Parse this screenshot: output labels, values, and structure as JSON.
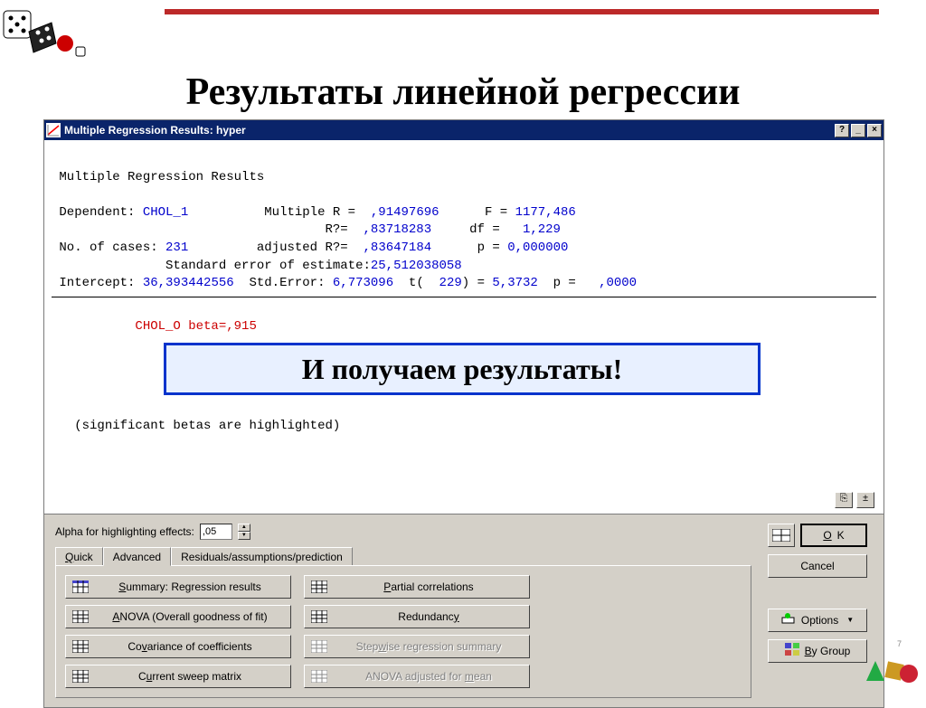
{
  "slide": {
    "title": "Результаты линейной регрессии",
    "callout": "И получаем результаты!"
  },
  "window": {
    "title": "Multiple Regression Results: hyper",
    "help_btn": "?",
    "min_btn": "_",
    "close_btn": "×"
  },
  "results": {
    "header": "Multiple Regression Results",
    "dep_label": "Dependent:",
    "dep_value": "CHOL_1",
    "multR_label": "Multiple R =",
    "multR_value": ",91497696",
    "F_label": "F =",
    "F_value": "1177,486",
    "R2_label": "R?=",
    "R2_value": ",83718283",
    "df_label": "df =",
    "df_value": "1,229",
    "ncases_label": "No. of cases:",
    "ncases_value": "231",
    "adjR2_label": "adjusted R?=",
    "adjR2_value": ",83647184",
    "p_label": "p =",
    "p_value": "0,000000",
    "stderr_label": "Standard error of estimate:",
    "stderr_value": "25,512038058",
    "intercept_label": "Intercept:",
    "intercept_value": "36,393442556",
    "std_err2_label": "Std.Error:",
    "std_err2_value": "6,773096",
    "t_label": "t(",
    "t_df": "229",
    "t_close": ") =",
    "t_value": "5,3732",
    "p2_label": "p =",
    "p2_value": ",0000",
    "beta_line": "CHOL_O beta=,915",
    "footnote": "(significant betas are highlighted)"
  },
  "controls": {
    "alpha_label": "Alpha for highlighting effects:",
    "alpha_value": ",05",
    "tabs": {
      "quick": "Quick",
      "advanced": "Advanced",
      "residuals": "Residuals/assumptions/prediction"
    },
    "buttons_left": {
      "summary": "Summary:  Regression results",
      "anova": "ANOVA (Overall goodness of fit)",
      "covariance": "Covariance of coefficients",
      "sweep": "Current sweep matrix"
    },
    "buttons_right": {
      "partial": "Partial correlations",
      "redundancy": "Redundancy",
      "stepwise": "Stepwise regression summary",
      "anova_adj": "ANOVA adjusted for mean"
    },
    "side": {
      "ok": "OK",
      "cancel": "Cancel",
      "options": "Options",
      "bygroup": "By Group"
    }
  }
}
